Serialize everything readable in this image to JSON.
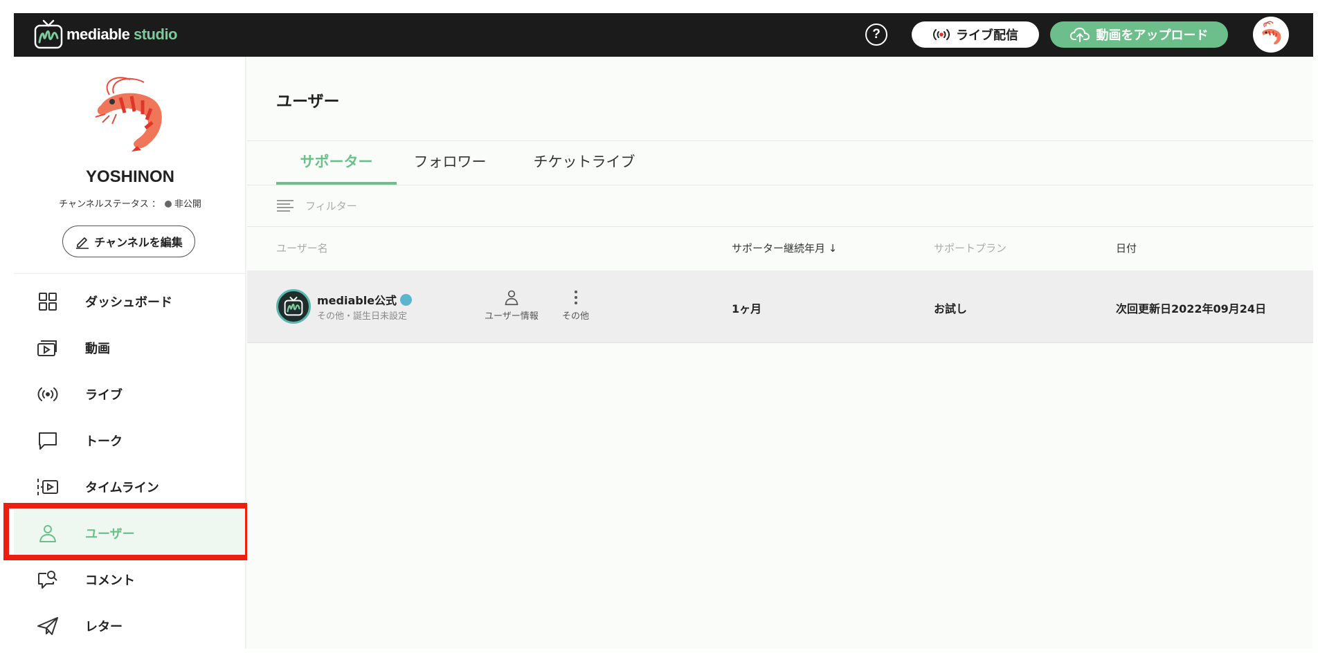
{
  "header": {
    "logo_text_1": "mediable",
    "logo_text_2": "studio",
    "help_label": "?",
    "live_label": "ライブ配信",
    "upload_label": "動画をアップロード",
    "brand_color": "#6cbf8b"
  },
  "sidebar": {
    "channel_name": "YOSHINON",
    "status_label": "チャンネルステータス ：",
    "status_value": "非公開",
    "edit_label": "チャンネルを編集",
    "items": [
      {
        "label": "ダッシュボード",
        "icon": "dashboard-icon"
      },
      {
        "label": "動画",
        "icon": "video-icon"
      },
      {
        "label": "ライブ",
        "icon": "live-icon"
      },
      {
        "label": "トーク",
        "icon": "talk-icon"
      },
      {
        "label": "タイムライン",
        "icon": "timeline-icon"
      },
      {
        "label": "ユーザー",
        "icon": "user-icon",
        "active": true
      },
      {
        "label": "コメント",
        "icon": "comment-icon"
      },
      {
        "label": "レター",
        "icon": "letter-icon"
      }
    ]
  },
  "main": {
    "title": "ユーザー",
    "tabs": [
      {
        "label": "サポーター",
        "active": true
      },
      {
        "label": "フォロワー"
      },
      {
        "label": "チケットライブ"
      }
    ],
    "filter_label": "フィルター",
    "columns": [
      "ユーザー名",
      "サポーター継続年月",
      "サポートプラン",
      "日付"
    ],
    "sort_indicator": "↓",
    "rows": [
      {
        "name": "mediable公式",
        "sub": "その他・誕生日未設定",
        "action_user_info": "ユーザー情報",
        "action_more": "その他",
        "duration": "1ヶ月",
        "plan": "お試し",
        "date": "次回更新日2022年09月24日"
      }
    ]
  }
}
